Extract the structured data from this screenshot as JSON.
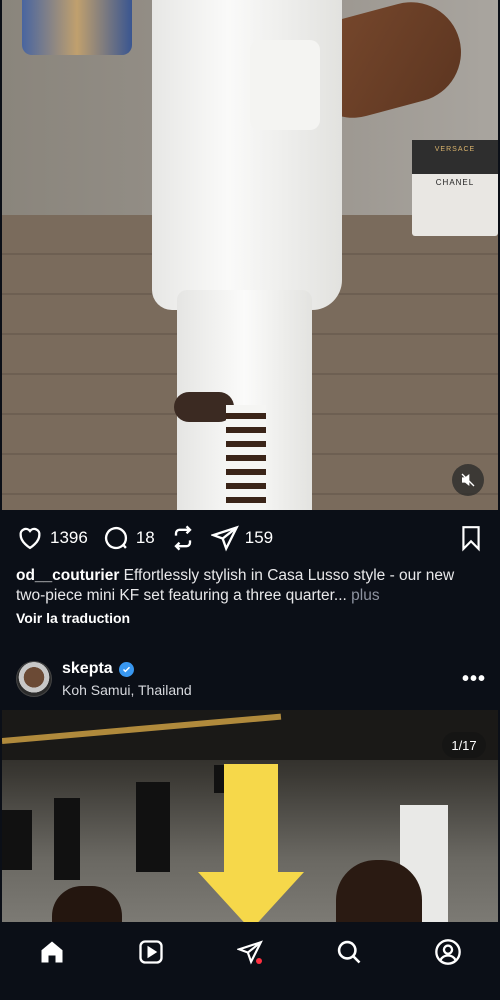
{
  "post1": {
    "likes": "1396",
    "comments": "18",
    "shares": "159",
    "caption_user": "od__couturier",
    "caption_text": " Effortlessly stylish in Casa Lusso style - our new two-piece mini KF set featuring a three quarter...",
    "caption_more": " plus",
    "translate_label": "Voir la traduction",
    "box_brand_top": "VERSACE",
    "box_brand": "CHANEL"
  },
  "post2": {
    "username": "skepta",
    "location": "Koh Samui, Thailand",
    "counter": "1/17",
    "more_label": "•••"
  },
  "icons": {
    "like": "heart-icon",
    "comment": "comment-icon",
    "repost": "repost-icon",
    "share": "paper-plane-icon",
    "save": "bookmark-icon",
    "mute": "muted-speaker-icon",
    "verified": "verified-badge-icon",
    "nav": [
      "home-icon",
      "reels-icon",
      "direct-messages-icon",
      "search-icon",
      "profile-icon"
    ]
  },
  "colors": {
    "background": "#0b0f17",
    "verified": "#3897f0",
    "notification_dot": "#ff3040",
    "highlight_arrow": "#f6d84a",
    "more_link": "#8d93a0"
  }
}
